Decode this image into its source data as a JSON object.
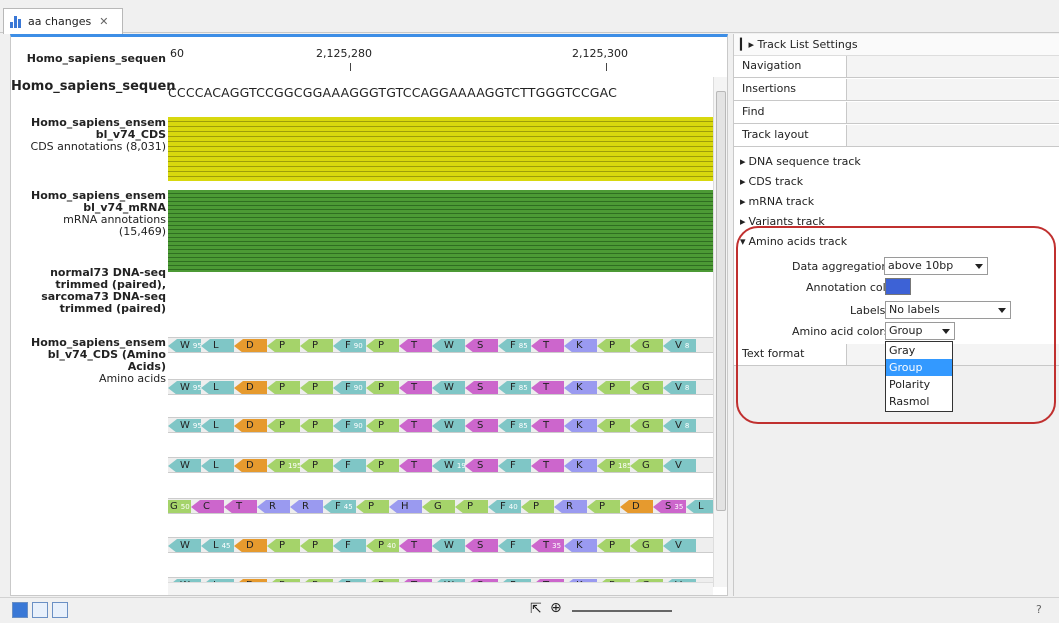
{
  "tab": {
    "title": "aa changes",
    "close": "✕"
  },
  "ruler": {
    "labels": [
      "60",
      "2,125,280",
      "2,125,300"
    ]
  },
  "tracks": {
    "dna": {
      "name": "Homo_sapiens_sequen",
      "sequence": "CCCCACAGGTCCGGCGGAAAGGGTGTCCAGGAAAAGGTCTTGGGTCCGAC"
    },
    "cds": {
      "name1": "Homo_sapiens_ensem",
      "name2": "bl_v74_CDS",
      "desc": "CDS annotations (8,031)"
    },
    "mrna": {
      "name1": "Homo_sapiens_ensem",
      "name2": "bl_v74_mRNA",
      "desc1": "mRNA annotations",
      "desc2": "(15,469)"
    },
    "variants": {
      "l1": "normal73 DNA-seq",
      "l2": "trimmed (paired),",
      "l3": "sarcoma73 DNA-seq",
      "l4": "trimmed (paired)"
    },
    "amino": {
      "name1": "Homo_sapiens_ensem",
      "name2": "bl_v74_CDS (Amino",
      "name3": "Acids)",
      "desc": "Amino acids"
    }
  },
  "aa_rows": [
    [
      [
        "W",
        "95"
      ],
      [
        "L",
        ""
      ],
      [
        "D",
        ""
      ],
      [
        "P",
        ""
      ],
      [
        "P",
        ""
      ],
      [
        "F",
        "90"
      ],
      [
        "P",
        ""
      ],
      [
        "T",
        ""
      ],
      [
        "W",
        ""
      ],
      [
        "S",
        ""
      ],
      [
        "F",
        "85"
      ],
      [
        "T",
        ""
      ],
      [
        "K",
        ""
      ],
      [
        "P",
        ""
      ],
      [
        "G",
        ""
      ],
      [
        "V",
        "8"
      ]
    ],
    [
      [
        "W",
        "95"
      ],
      [
        "L",
        ""
      ],
      [
        "D",
        ""
      ],
      [
        "P",
        ""
      ],
      [
        "P",
        ""
      ],
      [
        "F",
        "90"
      ],
      [
        "P",
        ""
      ],
      [
        "T",
        ""
      ],
      [
        "W",
        ""
      ],
      [
        "S",
        ""
      ],
      [
        "F",
        "85"
      ],
      [
        "T",
        ""
      ],
      [
        "K",
        ""
      ],
      [
        "P",
        ""
      ],
      [
        "G",
        ""
      ],
      [
        "V",
        "8"
      ]
    ],
    [
      [
        "W",
        "95"
      ],
      [
        "L",
        ""
      ],
      [
        "D",
        ""
      ],
      [
        "P",
        ""
      ],
      [
        "P",
        ""
      ],
      [
        "F",
        "90"
      ],
      [
        "P",
        ""
      ],
      [
        "T",
        ""
      ],
      [
        "W",
        ""
      ],
      [
        "S",
        ""
      ],
      [
        "F",
        "85"
      ],
      [
        "T",
        ""
      ],
      [
        "K",
        ""
      ],
      [
        "P",
        ""
      ],
      [
        "G",
        ""
      ],
      [
        "V",
        "8"
      ]
    ],
    [
      [
        "W",
        ""
      ],
      [
        "L",
        ""
      ],
      [
        "D",
        ""
      ],
      [
        "P",
        "195"
      ],
      [
        "P",
        ""
      ],
      [
        "F",
        ""
      ],
      [
        "P",
        ""
      ],
      [
        "T",
        ""
      ],
      [
        "W",
        "190"
      ],
      [
        "S",
        ""
      ],
      [
        "F",
        ""
      ],
      [
        "T",
        ""
      ],
      [
        "K",
        ""
      ],
      [
        "P",
        "185"
      ],
      [
        "G",
        ""
      ],
      [
        "V",
        ""
      ]
    ],
    [
      [
        "G",
        "50"
      ],
      [
        "C",
        ""
      ],
      [
        "T",
        ""
      ],
      [
        "R",
        ""
      ],
      [
        "R",
        ""
      ],
      [
        "F",
        "45"
      ],
      [
        "P",
        ""
      ],
      [
        "H",
        ""
      ],
      [
        "G",
        ""
      ],
      [
        "P",
        ""
      ],
      [
        "F",
        "40"
      ],
      [
        "P",
        ""
      ],
      [
        "R",
        ""
      ],
      [
        "P",
        ""
      ],
      [
        "D",
        ""
      ],
      [
        "S",
        "35"
      ],
      [
        "L",
        ""
      ]
    ],
    [
      [
        "W",
        ""
      ],
      [
        "L",
        "45"
      ],
      [
        "D",
        ""
      ],
      [
        "P",
        ""
      ],
      [
        "P",
        ""
      ],
      [
        "F",
        ""
      ],
      [
        "P",
        "40"
      ],
      [
        "T",
        ""
      ],
      [
        "W",
        ""
      ],
      [
        "S",
        ""
      ],
      [
        "F",
        ""
      ],
      [
        "T",
        "35"
      ],
      [
        "K",
        ""
      ],
      [
        "P",
        ""
      ],
      [
        "G",
        ""
      ],
      [
        "V",
        ""
      ]
    ],
    [
      [
        "W",
        ""
      ],
      [
        "L",
        ""
      ],
      [
        "D",
        "90"
      ],
      [
        "P",
        ""
      ],
      [
        "P",
        ""
      ],
      [
        "F",
        ""
      ],
      [
        "P",
        ""
      ],
      [
        "T",
        "85"
      ],
      [
        "W",
        ""
      ],
      [
        "S",
        ""
      ],
      [
        "F",
        ""
      ],
      [
        "T",
        ""
      ],
      [
        "K",
        "80"
      ],
      [
        "P",
        ""
      ],
      [
        "G",
        ""
      ],
      [
        "V",
        ""
      ]
    ]
  ],
  "aa_colors": {
    "W": "#7fc6c6",
    "L": "#7fc6c6",
    "D": "#e69a2e",
    "P": "#a5d36a",
    "F": "#7fc6c6",
    "T": "#cc66cc",
    "S": "#cc66cc",
    "K": "#9a9af0",
    "G": "#a5d36a",
    "V": "#7fc6c6",
    "C": "#cc66cc",
    "R": "#9a9af0",
    "H": "#9a9af0"
  },
  "side": {
    "header": "Track List Settings",
    "sections": {
      "navigation": "Navigation",
      "insertions": "Insertions",
      "find": "Find",
      "layout": "Track layout",
      "text": "Text format"
    },
    "tree": {
      "dna": "DNA sequence track",
      "cds": "CDS track",
      "mrna": "mRNA track",
      "variants": "Variants track",
      "amino": "Amino acids track"
    },
    "fields": {
      "agg_label": "Data aggregation",
      "agg_value": "above 10bp",
      "color_label": "Annotation color",
      "color_value": "#3d62d6",
      "labels_label": "Labels",
      "labels_value": "No labels",
      "aacol_label": "Amino acid colors",
      "aacol_value": "Group"
    },
    "dropdown": [
      "Gray",
      "Group",
      "Polarity",
      "Rasmol"
    ],
    "footer_q": "?"
  },
  "accent": "#3d8ee6",
  "highlight_color": "#c0302f"
}
